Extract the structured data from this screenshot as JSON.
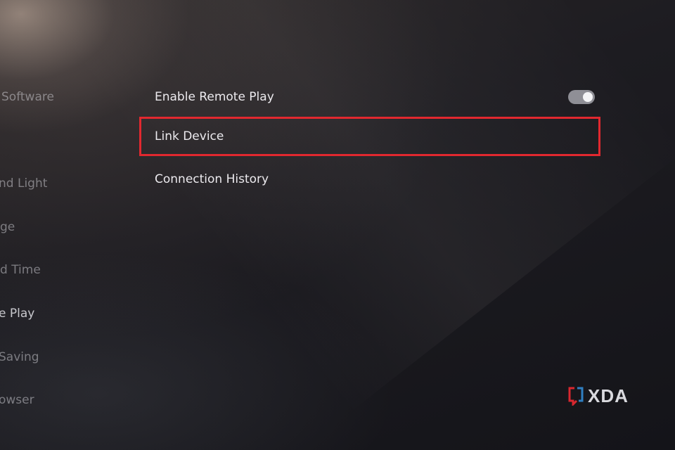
{
  "sidebar": {
    "items": [
      {
        "label": "Software"
      },
      {
        "label": "nd Light"
      },
      {
        "label": "ge"
      },
      {
        "label": "d Time"
      },
      {
        "label": "e Play",
        "active": true
      },
      {
        "label": "Saving"
      },
      {
        "label": "owser"
      }
    ]
  },
  "menu": {
    "items": [
      {
        "label": "Enable Remote Play",
        "toggle_on": true
      },
      {
        "label": "Link Device",
        "highlighted": true
      },
      {
        "label": "Connection History"
      }
    ]
  },
  "colors": {
    "highlight_border": "#e1282f",
    "toggle_track": "#8f8f96"
  },
  "watermark": {
    "text": "XDA",
    "icon": "xda-logo-icon"
  }
}
